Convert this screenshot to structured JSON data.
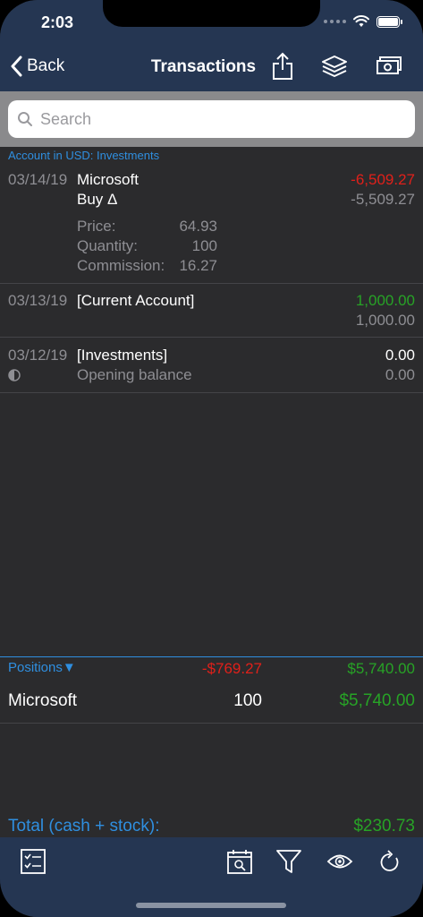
{
  "status": {
    "time": "2:03"
  },
  "nav": {
    "back_label": "Back",
    "title": "Transactions",
    "icons": [
      "share-icon",
      "layers-icon",
      "cash-icon"
    ]
  },
  "search": {
    "placeholder": "Search"
  },
  "account_header": "Account in USD: Investments",
  "transactions": [
    {
      "date": "03/14/19",
      "payee": "Microsoft",
      "subtitle": "Buy Δ",
      "amount": "-6,509.27",
      "balance": "-5,509.27",
      "details": [
        {
          "label": "Price:",
          "value": "64.93"
        },
        {
          "label": "Quantity:",
          "value": "100"
        },
        {
          "label": "Commission:",
          "value": "16.27"
        }
      ]
    },
    {
      "date": "03/13/19",
      "payee": "[Current Account]",
      "amount": "1,000.00",
      "balance": "1,000.00"
    },
    {
      "date": "03/12/19",
      "payee": "[Investments]",
      "subtitle": "Opening balance",
      "amount": "0.00",
      "balance": "0.00"
    }
  ],
  "positions": {
    "header_label": "Positions▼",
    "gain": "-$769.27",
    "value": "$5,740.00",
    "rows": [
      {
        "name": "Microsoft",
        "quantity": "100",
        "value": "$5,740.00"
      }
    ]
  },
  "total": {
    "label": "Total (cash + stock):",
    "value": "$230.73"
  },
  "toolbar": {
    "icons": [
      "checklist-icon",
      "calendar-search-icon",
      "filter-icon",
      "eye-icon",
      "refresh-icon"
    ]
  },
  "colors": {
    "nav_bg": "#253652",
    "accent": "#2f8fe0",
    "negative": "#e0201a",
    "positive": "#27a326"
  }
}
